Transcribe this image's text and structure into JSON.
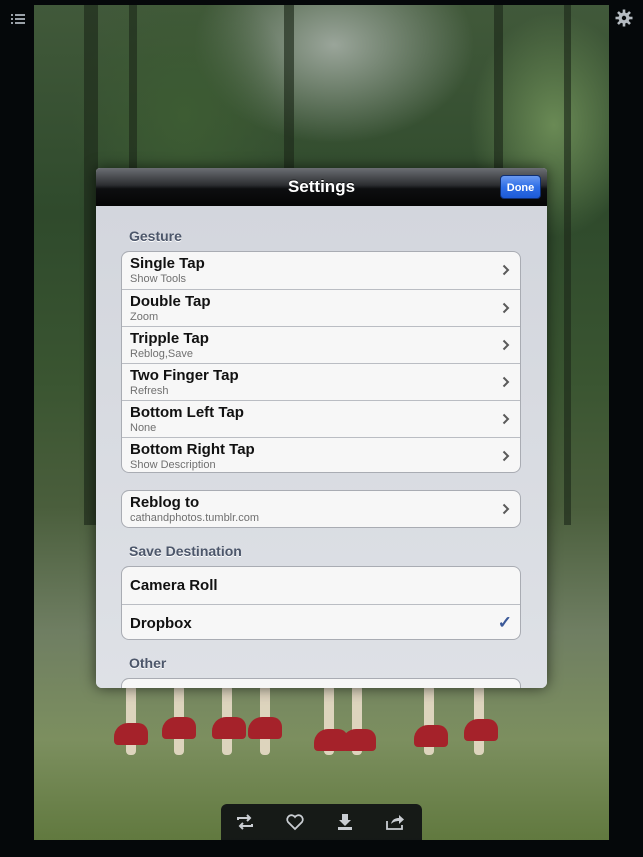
{
  "modal": {
    "title": "Settings",
    "done_label": "Done"
  },
  "sections": {
    "gesture": "Gesture",
    "save_destination": "Save Destination",
    "other": "Other"
  },
  "gesture_rows": [
    {
      "title": "Single Tap",
      "value": "Show Tools"
    },
    {
      "title": "Double Tap",
      "value": "Zoom"
    },
    {
      "title": "Tripple Tap",
      "value": "Reblog,Save"
    },
    {
      "title": "Two Finger Tap",
      "value": "Refresh"
    },
    {
      "title": "Bottom Left Tap",
      "value": "None"
    },
    {
      "title": "Bottom Right Tap",
      "value": "Show Description"
    }
  ],
  "reblog": {
    "title": "Reblog to",
    "value": "cathandphotos.tumblr.com"
  },
  "save_rows": [
    {
      "title": "Camera Roll",
      "checked": false
    },
    {
      "title": "Dropbox",
      "checked": true
    }
  ],
  "check_glyph": "✓",
  "icons": {
    "top_left": "list-icon",
    "top_right": "gear-icon",
    "toolbar": [
      "repost-icon",
      "heart-icon",
      "download-icon",
      "share-icon"
    ]
  },
  "colors": {
    "done_button": "#2f6fe7",
    "section_header": "#4c566a",
    "checkmark": "#3b5998"
  }
}
